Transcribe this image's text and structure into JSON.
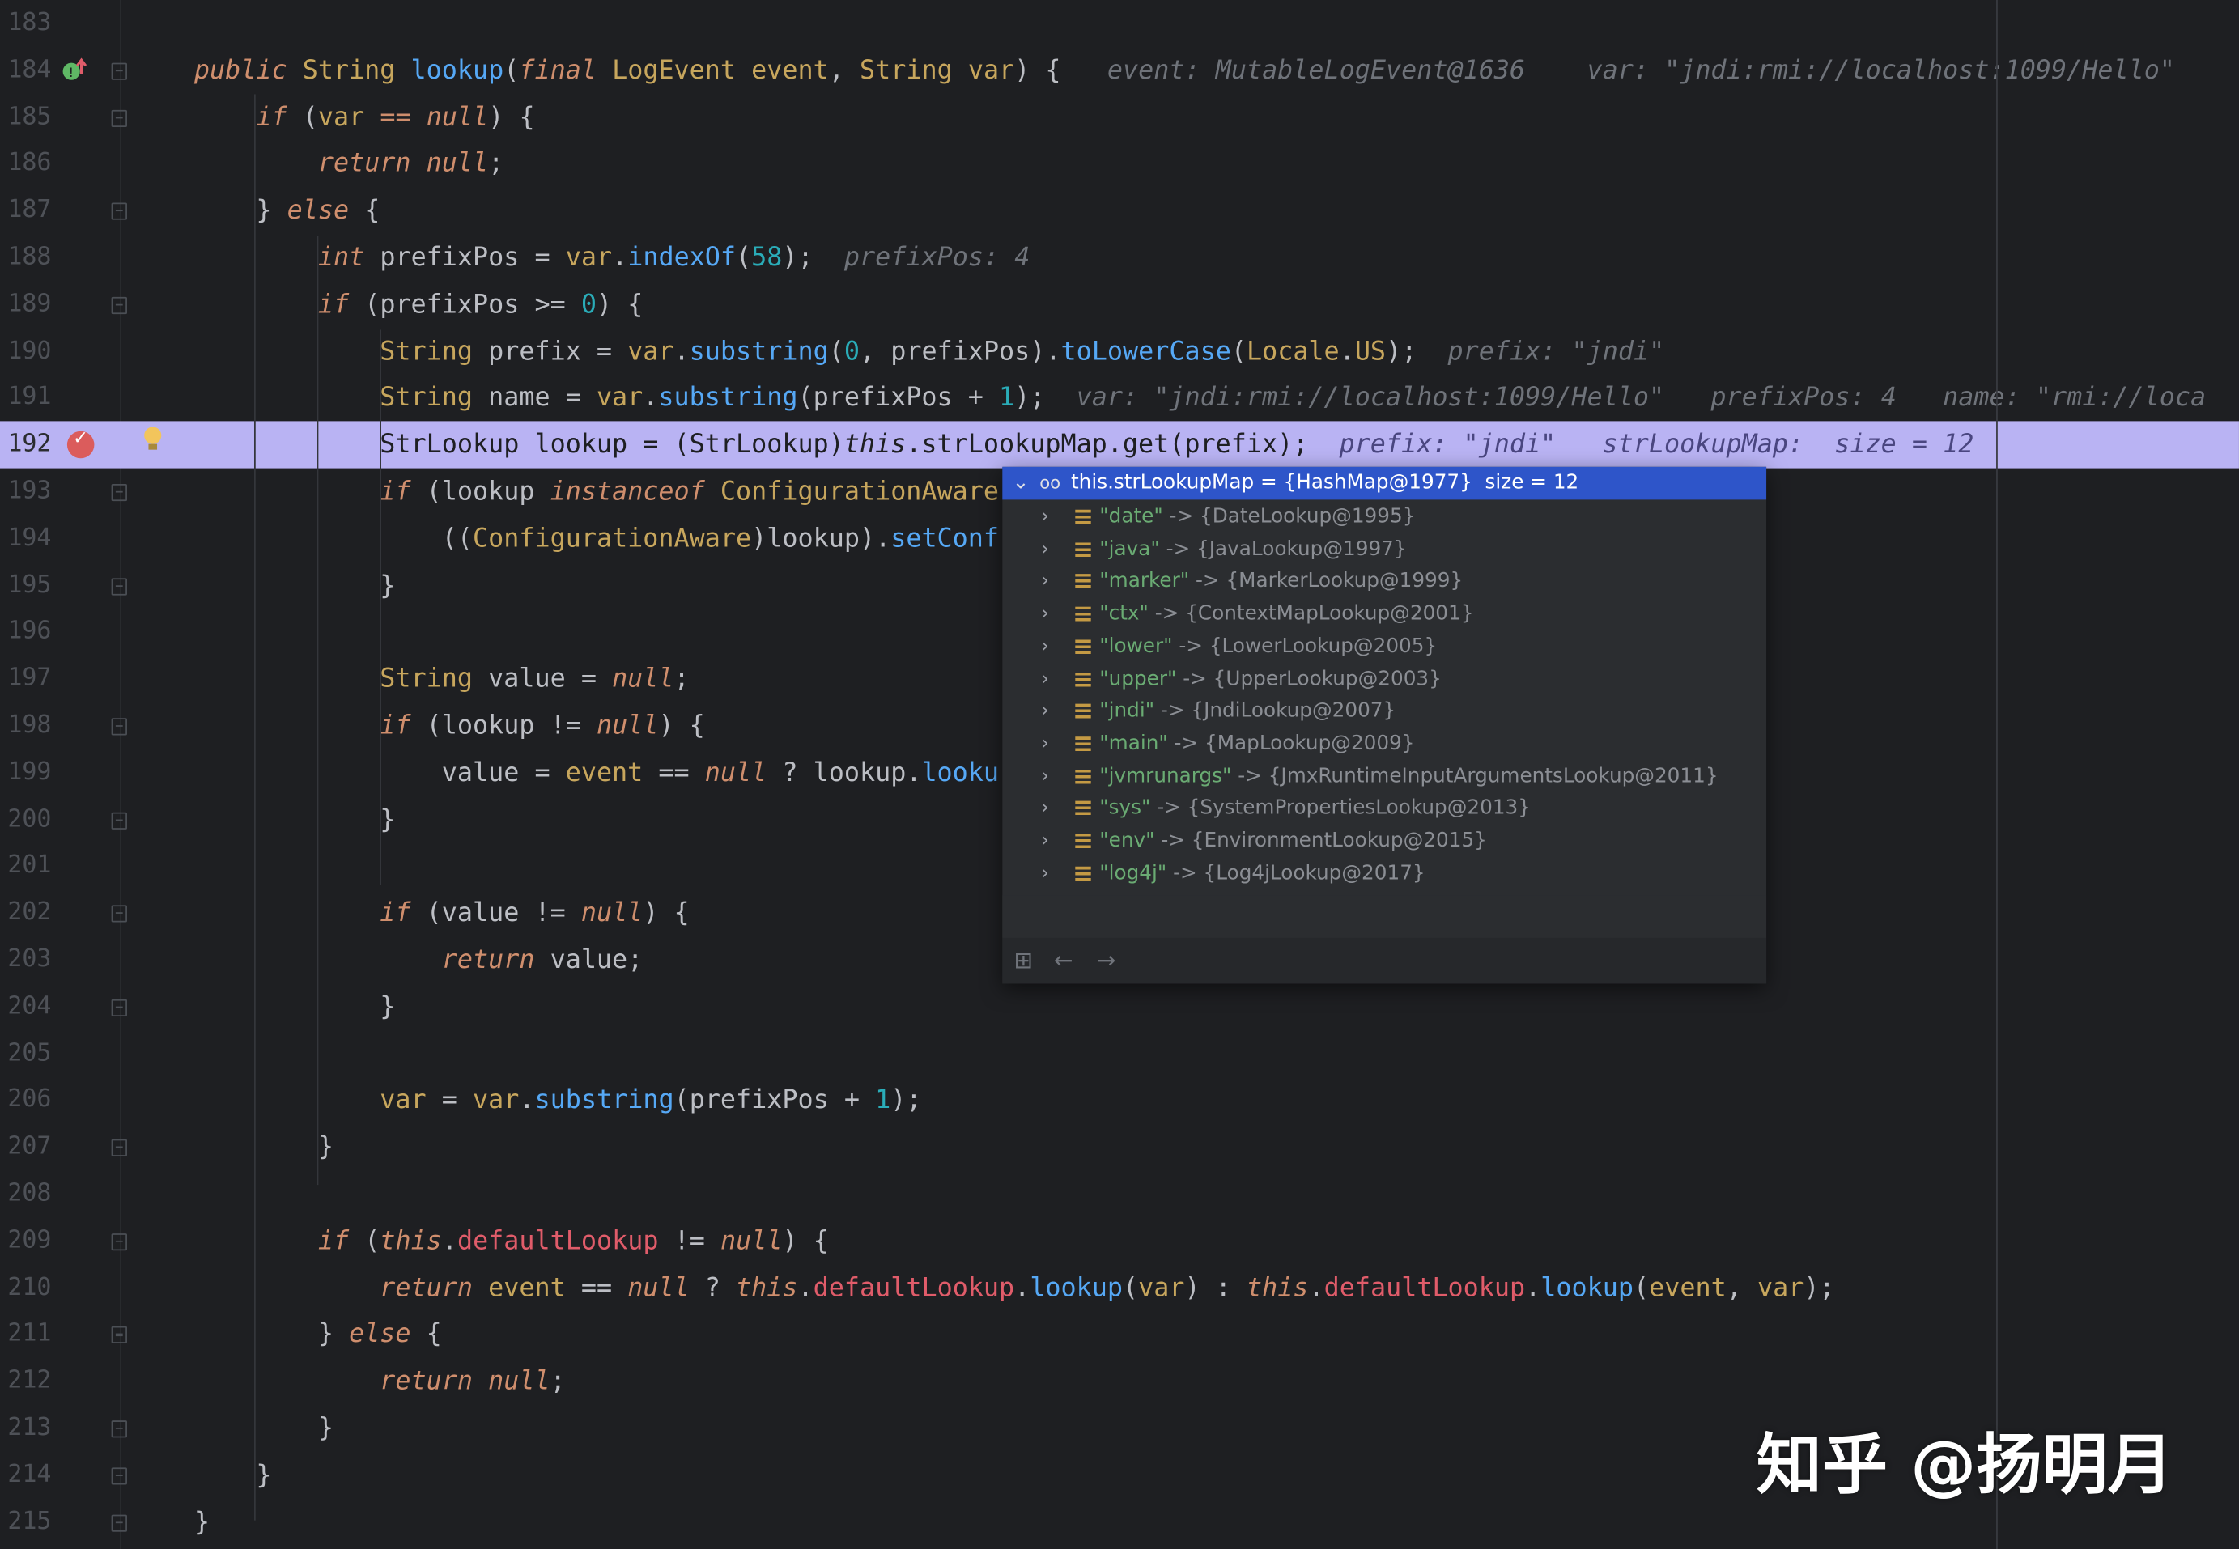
{
  "editor": {
    "lines": [
      {
        "n": "183",
        "segs": []
      },
      {
        "n": "184",
        "segs": [
          [
            "ki",
            "public "
          ],
          [
            "t",
            "String "
          ],
          [
            "m",
            "lookup"
          ],
          [
            "",
            "("
          ],
          [
            "ki",
            "final "
          ],
          [
            "t",
            "LogEvent "
          ],
          [
            "t",
            "event"
          ],
          [
            "",
            ", "
          ],
          [
            "t",
            "String "
          ],
          [
            "t",
            "var"
          ],
          [
            "",
            ") {   "
          ],
          [
            "hint",
            "event: MutableLogEvent@1636    var: \"jndi:rmi://localhost:1099/Hello\""
          ]
        ]
      },
      {
        "n": "185",
        "segs": [
          [
            "",
            "    "
          ],
          [
            "ki",
            "if "
          ],
          [
            "",
            "("
          ],
          [
            "t",
            "var"
          ],
          [
            "k",
            " == "
          ],
          [
            "ki",
            "null"
          ],
          [
            "",
            ") {"
          ]
        ]
      },
      {
        "n": "186",
        "segs": [
          [
            "",
            "        "
          ],
          [
            "ki",
            "return "
          ],
          [
            "ki",
            "null"
          ],
          [
            "",
            ";"
          ]
        ]
      },
      {
        "n": "187",
        "segs": [
          [
            "",
            "    } "
          ],
          [
            "ki",
            "else "
          ],
          [
            "",
            "{"
          ]
        ]
      },
      {
        "n": "188",
        "segs": [
          [
            "",
            "        "
          ],
          [
            "ki",
            "int "
          ],
          [
            "",
            "prefixPos = "
          ],
          [
            "t",
            "var"
          ],
          [
            "",
            "."
          ],
          [
            "m",
            "indexOf"
          ],
          [
            "",
            "("
          ],
          [
            "n",
            "58"
          ],
          [
            "",
            ");  "
          ],
          [
            "hint",
            "prefixPos: 4"
          ]
        ]
      },
      {
        "n": "189",
        "segs": [
          [
            "",
            "        "
          ],
          [
            "ki",
            "if "
          ],
          [
            "",
            "(prefixPos >= "
          ],
          [
            "n",
            "0"
          ],
          [
            "",
            ") {"
          ]
        ]
      },
      {
        "n": "190",
        "segs": [
          [
            "",
            "            "
          ],
          [
            "t",
            "String "
          ],
          [
            "",
            "prefix = "
          ],
          [
            "t",
            "var"
          ],
          [
            "",
            "."
          ],
          [
            "m",
            "substring"
          ],
          [
            "",
            "("
          ],
          [
            "n",
            "0"
          ],
          [
            "",
            ", prefixPos)."
          ],
          [
            "m",
            "toLowerCase"
          ],
          [
            "",
            "("
          ],
          [
            "t",
            "Locale"
          ],
          [
            "",
            "."
          ],
          [
            "t",
            "US"
          ],
          [
            "",
            ");  "
          ],
          [
            "hint",
            "prefix: \"jndi\""
          ]
        ]
      },
      {
        "n": "191",
        "segs": [
          [
            "",
            "            "
          ],
          [
            "t",
            "String "
          ],
          [
            "",
            "name = "
          ],
          [
            "t",
            "var"
          ],
          [
            "",
            "."
          ],
          [
            "m",
            "substring"
          ],
          [
            "",
            "(prefixPos + "
          ],
          [
            "n",
            "1"
          ],
          [
            "",
            ");  "
          ],
          [
            "hint",
            "var: \"jndi:rmi://localhost:1099/Hello\"   prefixPos: 4   name: \"rmi://loca"
          ]
        ]
      },
      {
        "n": "192",
        "exec": true,
        "segs": [
          [
            "",
            "            StrLookup lookup = (StrLookup)"
          ],
          [
            "ki",
            "this"
          ],
          [
            "",
            ".strLookupMap.get(prefix);  "
          ],
          [
            "hint",
            "prefix: \"jndi\"   strLookupMap:  size = 12"
          ]
        ]
      },
      {
        "n": "193",
        "segs": [
          [
            "",
            "            "
          ],
          [
            "ki",
            "if "
          ],
          [
            "",
            "(lookup "
          ],
          [
            "ki",
            "instanceof "
          ],
          [
            "t",
            "ConfigurationAware"
          ]
        ]
      },
      {
        "n": "194",
        "segs": [
          [
            "",
            "                (("
          ],
          [
            "t",
            "ConfigurationAware"
          ],
          [
            "",
            ")lookup)."
          ],
          [
            "m",
            "setConf"
          ]
        ]
      },
      {
        "n": "195",
        "segs": [
          [
            "",
            "            }"
          ]
        ]
      },
      {
        "n": "196",
        "segs": []
      },
      {
        "n": "197",
        "segs": [
          [
            "",
            "            "
          ],
          [
            "t",
            "String "
          ],
          [
            "",
            "value = "
          ],
          [
            "ki",
            "null"
          ],
          [
            "",
            ";"
          ]
        ]
      },
      {
        "n": "198",
        "segs": [
          [
            "",
            "            "
          ],
          [
            "ki",
            "if "
          ],
          [
            "",
            "(lookup != "
          ],
          [
            "ki",
            "null"
          ],
          [
            "",
            ") {"
          ]
        ]
      },
      {
        "n": "199",
        "segs": [
          [
            "",
            "                value = "
          ],
          [
            "t",
            "event"
          ],
          [
            "",
            " == "
          ],
          [
            "ki",
            "null"
          ],
          [
            "",
            " ? lookup."
          ],
          [
            "m",
            "looku"
          ]
        ]
      },
      {
        "n": "200",
        "segs": [
          [
            "",
            "            }"
          ]
        ]
      },
      {
        "n": "201",
        "segs": []
      },
      {
        "n": "202",
        "segs": [
          [
            "",
            "            "
          ],
          [
            "ki",
            "if "
          ],
          [
            "",
            "(value != "
          ],
          [
            "ki",
            "null"
          ],
          [
            "",
            ") {"
          ]
        ]
      },
      {
        "n": "203",
        "segs": [
          [
            "",
            "                "
          ],
          [
            "ki",
            "return "
          ],
          [
            "",
            "value;"
          ]
        ]
      },
      {
        "n": "204",
        "segs": [
          [
            "",
            "            }"
          ]
        ]
      },
      {
        "n": "205",
        "segs": []
      },
      {
        "n": "206",
        "segs": [
          [
            "",
            "            "
          ],
          [
            "t",
            "var"
          ],
          [
            "",
            " = "
          ],
          [
            "t",
            "var"
          ],
          [
            "",
            "."
          ],
          [
            "m",
            "substring"
          ],
          [
            "",
            "(prefixPos + "
          ],
          [
            "n",
            "1"
          ],
          [
            "",
            ");"
          ]
        ]
      },
      {
        "n": "207",
        "segs": [
          [
            "",
            "        }"
          ]
        ]
      },
      {
        "n": "208",
        "segs": []
      },
      {
        "n": "209",
        "segs": [
          [
            "",
            "        "
          ],
          [
            "ki",
            "if "
          ],
          [
            "",
            "("
          ],
          [
            "ki",
            "this"
          ],
          [
            "",
            "."
          ],
          [
            "fr",
            "defaultLookup"
          ],
          [
            "",
            " != "
          ],
          [
            "ki",
            "null"
          ],
          [
            "",
            ") {"
          ]
        ]
      },
      {
        "n": "210",
        "segs": [
          [
            "",
            "            "
          ],
          [
            "ki",
            "return "
          ],
          [
            "t",
            "event"
          ],
          [
            "",
            " == "
          ],
          [
            "ki",
            "null"
          ],
          [
            "",
            " ? "
          ],
          [
            "ki",
            "this"
          ],
          [
            "",
            "."
          ],
          [
            "fr",
            "defaultLookup"
          ],
          [
            "",
            "."
          ],
          [
            "m",
            "lookup"
          ],
          [
            "",
            "("
          ],
          [
            "t",
            "var"
          ],
          [
            "",
            ") : "
          ],
          [
            "ki",
            "this"
          ],
          [
            "",
            "."
          ],
          [
            "fr",
            "defaultLookup"
          ],
          [
            "",
            "."
          ],
          [
            "m",
            "lookup"
          ],
          [
            "",
            "("
          ],
          [
            "t",
            "event"
          ],
          [
            "",
            ", "
          ],
          [
            "t",
            "var"
          ],
          [
            "",
            ");"
          ]
        ]
      },
      {
        "n": "211",
        "segs": [
          [
            "",
            "        } "
          ],
          [
            "ki",
            "else "
          ],
          [
            "",
            "{"
          ]
        ]
      },
      {
        "n": "212",
        "segs": [
          [
            "",
            "            "
          ],
          [
            "ki",
            "return "
          ],
          [
            "ki",
            "null"
          ],
          [
            "",
            ";"
          ]
        ]
      },
      {
        "n": "213",
        "segs": [
          [
            "",
            "        }"
          ]
        ]
      },
      {
        "n": "214",
        "segs": [
          [
            "",
            "    }"
          ]
        ]
      },
      {
        "n": "215",
        "segs": [
          [
            "",
            "}"
          ]
        ]
      }
    ]
  },
  "popup": {
    "header": "this.strLookupMap = {HashMap@1977}  size = 12",
    "entries": [
      {
        "key": "\"date\"",
        "val": " -> {DateLookup@1995}"
      },
      {
        "key": "\"java\"",
        "val": " -> {JavaLookup@1997}"
      },
      {
        "key": "\"marker\"",
        "val": " -> {MarkerLookup@1999}"
      },
      {
        "key": "\"ctx\"",
        "val": " -> {ContextMapLookup@2001}"
      },
      {
        "key": "\"lower\"",
        "val": " -> {LowerLookup@2005}"
      },
      {
        "key": "\"upper\"",
        "val": " -> {UpperLookup@2003}"
      },
      {
        "key": "\"jndi\"",
        "val": " -> {JndiLookup@2007}"
      },
      {
        "key": "\"main\"",
        "val": " -> {MapLookup@2009}"
      },
      {
        "key": "\"jvmrunargs\"",
        "val": " -> {JmxRuntimeInputArgumentsLookup@2011}"
      },
      {
        "key": "\"sys\"",
        "val": " -> {SystemPropertiesLookup@2013}"
      },
      {
        "key": "\"env\"",
        "val": " -> {EnvironmentLookup@2015}"
      },
      {
        "key": "\"log4j\"",
        "val": " -> {Log4jLookup@2017}"
      }
    ],
    "footer": {
      "back": "←",
      "forward": "→"
    }
  },
  "watermark": "知乎 @扬明月",
  "colors": {
    "exec_line": "#b9b3f3",
    "keyword": "#cf8e6d",
    "popup_header": "#2e55c9",
    "map_key": "#6aab73"
  },
  "icons": {
    "override": "override-icon",
    "breakpoint": "breakpoint-icon",
    "intention": "bulb-icon",
    "watch": "watch-icon",
    "tree": "tree-view-icon"
  }
}
